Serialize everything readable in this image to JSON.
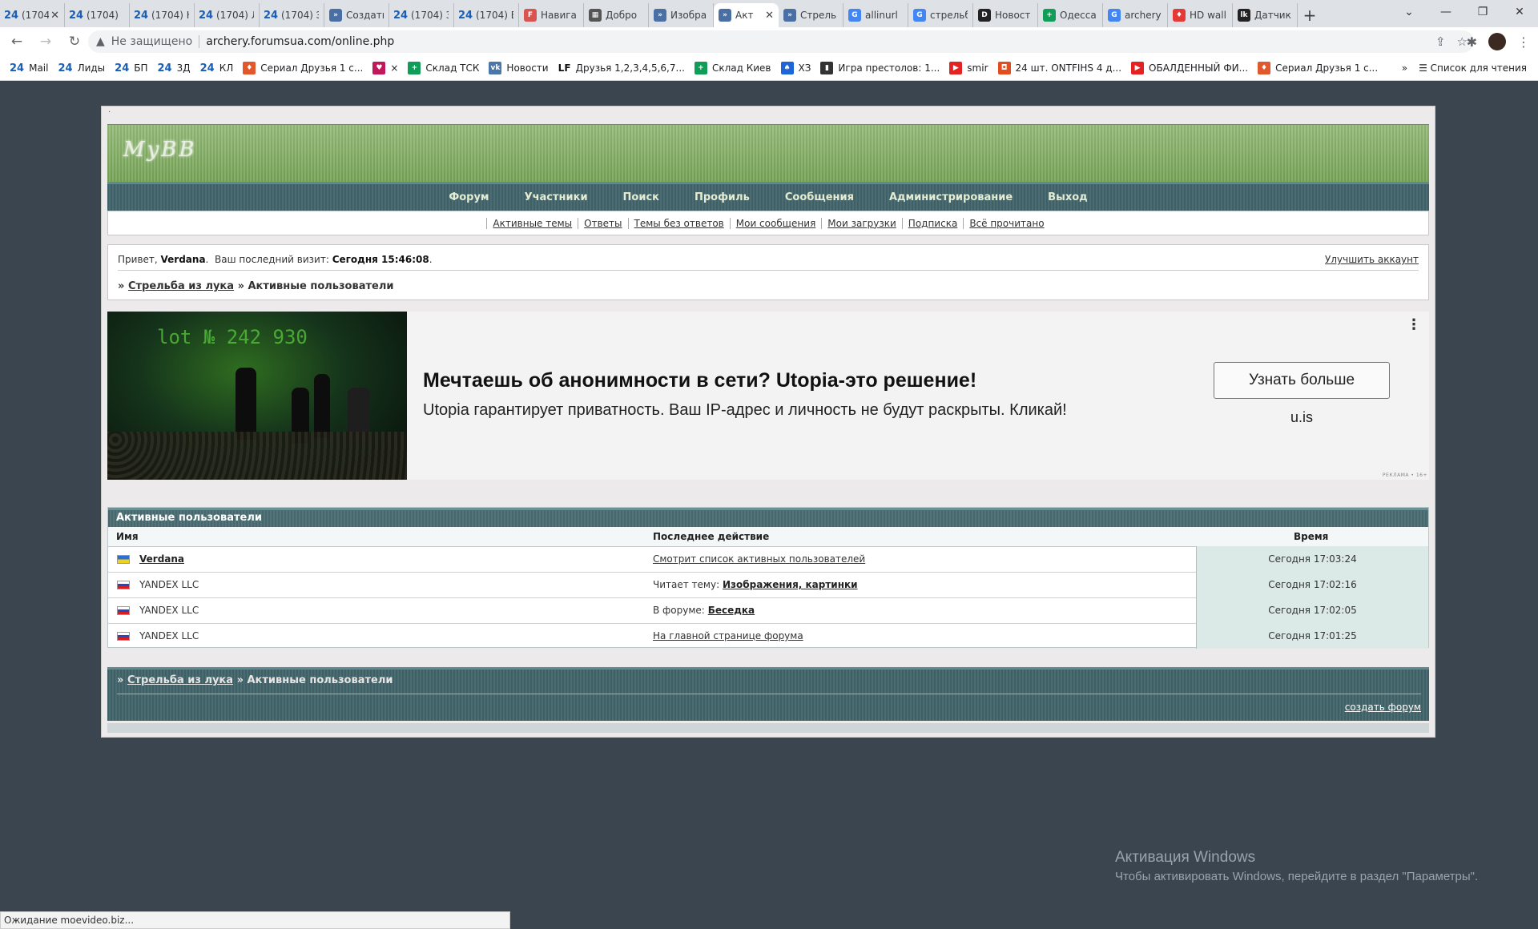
{
  "browser": {
    "tabs": [
      {
        "title": "(1704)",
        "icon": "24",
        "color": "#1a5fb4"
      },
      {
        "title": "(1704)",
        "icon": "24",
        "color": "#1a5fb4"
      },
      {
        "title": "(1704) Н",
        "icon": "24",
        "color": "#1a5fb4"
      },
      {
        "title": "(1704) Л",
        "icon": "24",
        "color": "#1a5fb4"
      },
      {
        "title": "(1704) Э",
        "icon": "24",
        "color": "#1a5fb4"
      },
      {
        "title": "Создать",
        "icon": "»",
        "color": "#4a6fa5"
      },
      {
        "title": "(1704) З",
        "icon": "24",
        "color": "#1a5fb4"
      },
      {
        "title": "(1704) В",
        "icon": "24",
        "color": "#1a5fb4"
      },
      {
        "title": "Навига",
        "icon": "F",
        "color": "#d9534f"
      },
      {
        "title": "Добро",
        "icon": "▦",
        "color": "#555"
      },
      {
        "title": "Изобра",
        "icon": "»",
        "color": "#4a6fa5"
      },
      {
        "title": "Акт",
        "icon": "»",
        "color": "#4a6fa5",
        "active": true
      },
      {
        "title": "Стрель",
        "icon": "»",
        "color": "#4a6fa5"
      },
      {
        "title": "allinurl",
        "icon": "G",
        "color": "#4285f4"
      },
      {
        "title": "стрельб",
        "icon": "G",
        "color": "#4285f4"
      },
      {
        "title": "Новост",
        "icon": "D",
        "color": "#222"
      },
      {
        "title": "Одесса",
        "icon": "+",
        "color": "#0f9d58"
      },
      {
        "title": "archery",
        "icon": "G",
        "color": "#4285f4"
      },
      {
        "title": "HD wall",
        "icon": "♦",
        "color": "#e53935"
      },
      {
        "title": "Датчик",
        "icon": "lk",
        "color": "#222"
      }
    ],
    "new_tab": "+",
    "security": "Не защищено",
    "url": "archery.forumsua.com/online.php",
    "bookmarks": [
      {
        "label": "Mail",
        "icon": "24"
      },
      {
        "label": "Лиды",
        "icon": "24"
      },
      {
        "label": "БП",
        "icon": "24"
      },
      {
        "label": "3Д",
        "icon": "24"
      },
      {
        "label": "КЛ",
        "icon": "24"
      },
      {
        "label": "Сериал Друзья 1 с...",
        "icon": "♦"
      },
      {
        "label": "×",
        "icon": "♥"
      },
      {
        "label": "Склад ТСК",
        "icon": "+"
      },
      {
        "label": "Новости",
        "icon": "vk"
      },
      {
        "label": "Друзья 1,2,3,4,5,6,7...",
        "icon": "LF"
      },
      {
        "label": "Склад Киев",
        "icon": "+"
      },
      {
        "label": "ХЗ",
        "icon": "♠"
      },
      {
        "label": "Игра престолов: 1...",
        "icon": "▮"
      },
      {
        "label": "smir",
        "icon": "▶"
      },
      {
        "label": "24 шт. ONTFIHS 4 д...",
        "icon": "◘"
      },
      {
        "label": "ОБАЛДЕННЫЙ ФИ...",
        "icon": "▶"
      },
      {
        "label": "Сериал Друзья 1 с...",
        "icon": "♦"
      }
    ],
    "reading_list": "Список для чтения",
    "status_text": "Ожидание moevideo.biz..."
  },
  "forum": {
    "header_dot": "·",
    "logo": "MyBB",
    "main_nav": [
      "Форум",
      "Участники",
      "Поиск",
      "Профиль",
      "Сообщения",
      "Администрирование",
      "Выход"
    ],
    "sub_nav": [
      "Активные темы",
      "Ответы",
      "Темы без ответов",
      "Мои сообщения",
      "Мои загрузки",
      "Подписка",
      "Всё прочитано"
    ],
    "greeting_prefix": "Привет,",
    "username": "Verdana",
    "last_visit_label": "Ваш последний визит:",
    "last_visit_value": "Сегодня 15:46:08",
    "upgrade": "Улучшить аккаунт",
    "breadcrumb_root": "Стрельба из лука",
    "breadcrumb_current": "Активные пользователи"
  },
  "ad": {
    "image_text": "lot № 242 930",
    "title": "Мечтаешь об анонимности в сети? Utopia-это решение!",
    "text": "Utopia гарантирует приватность. Ваш IP-адрес и личность не будут раскрыты. Кликай!",
    "button": "Узнать больше",
    "domain": "u.is",
    "menu": "⋮",
    "mark": "РЕКЛАМА • 16+"
  },
  "active_users": {
    "caption": "Активные пользователи",
    "columns": [
      "Имя",
      "Последнее действие",
      "Время"
    ],
    "rows": [
      {
        "flag": "ua",
        "name": "Verdana",
        "action_prefix": "",
        "action_link": "Смотрит список активных пользователей",
        "time": "Сегодня 17:03:24"
      },
      {
        "flag": "ru",
        "name": "YANDEX LLC",
        "action_prefix": "Читает тему:",
        "action_link": "Изображения, картинки",
        "time": "Сегодня 17:02:16"
      },
      {
        "flag": "ru",
        "name": "YANDEX LLC",
        "action_prefix": "В форуме:",
        "action_link": "Беседка",
        "time": "Сегодня 17:02:05"
      },
      {
        "flag": "ru",
        "name": "YANDEX LLC",
        "action_prefix": "",
        "action_link": "На главной странице форума",
        "time": "Сегодня 17:01:25"
      }
    ]
  },
  "footer": {
    "breadcrumb_root": "Стрельба из лука",
    "breadcrumb_current": "Активные пользователи",
    "create_forum": "создать форум"
  },
  "windows_watermark": {
    "title": "Активация Windows",
    "text": "Чтобы активировать Windows, перейдите в раздел \"Параметры\"."
  }
}
